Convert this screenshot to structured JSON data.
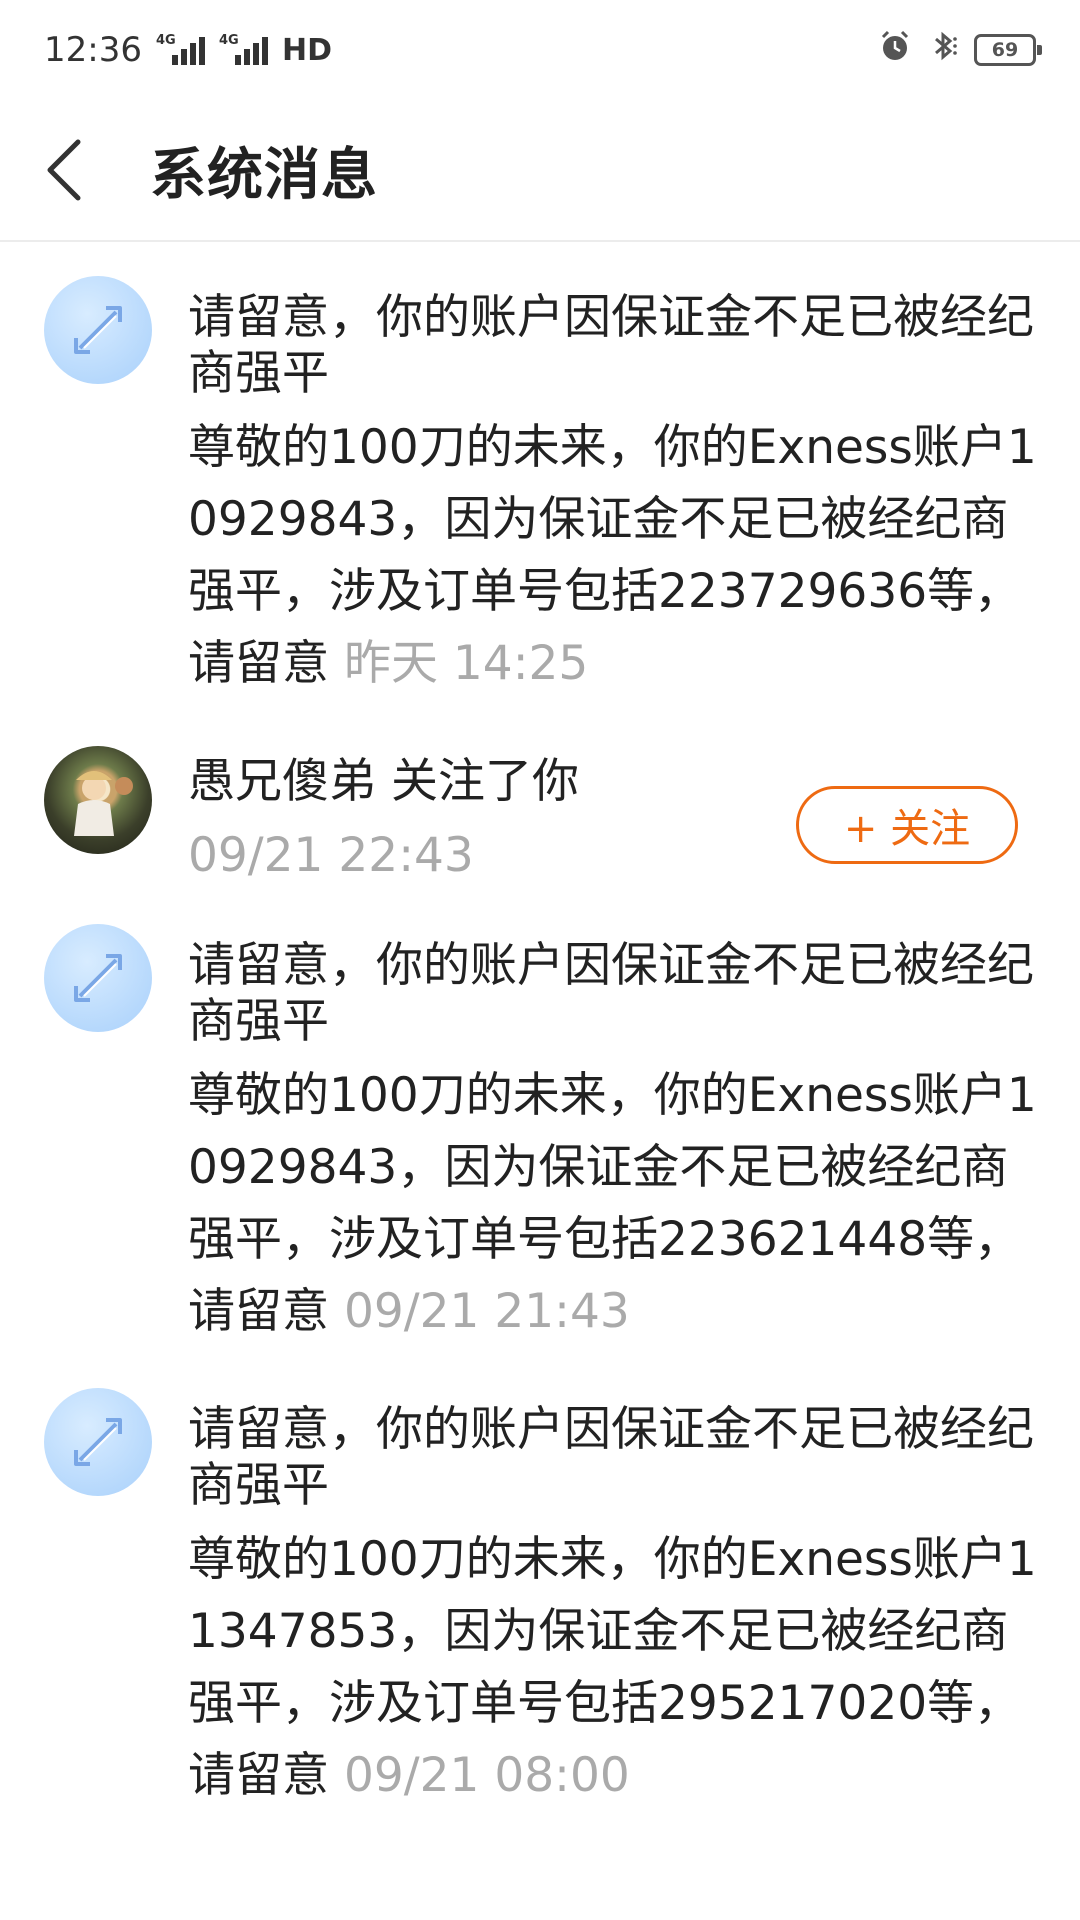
{
  "status_bar": {
    "time": "12:36",
    "network1": "4G",
    "network2": "4G",
    "hd": "HD",
    "battery": "69"
  },
  "header": {
    "title": "系统消息"
  },
  "messages": [
    {
      "type": "system",
      "title": "请留意，你的账户因保证金不足已被经纪商强平",
      "body": "尊敬的100刀的未来，你的Exness账户10929843，因为保证金不足已被经纪商强平，涉及订单号包括223729636等，请留意",
      "time": "昨天 14:25"
    },
    {
      "type": "follow",
      "text": "愚兄傻弟 关注了你",
      "time": "09/21 22:43",
      "button": "+ 关注"
    },
    {
      "type": "system",
      "title": "请留意，你的账户因保证金不足已被经纪商强平",
      "body": "尊敬的100刀的未来，你的Exness账户10929843，因为保证金不足已被经纪商强平，涉及订单号包括223621448等，请留意",
      "time": "09/21 21:43"
    },
    {
      "type": "system",
      "title": "请留意，你的账户因保证金不足已被经纪商强平",
      "body": "尊敬的100刀的未来，你的Exness账户11347853，因为保证金不足已被经纪商强平，涉及订单号包括295217020等，请留意",
      "time": "09/21 08:00"
    }
  ],
  "colors": {
    "accent": "#ee6a12",
    "timestamp": "#aaaaaa",
    "avatar_bg": "#a8d0fb"
  },
  "icons": {
    "back": "chevron-left-icon",
    "system_avatar": "expand-arrows-icon",
    "alarm": "alarm-clock-icon",
    "bluetooth": "bluetooth-icon"
  }
}
